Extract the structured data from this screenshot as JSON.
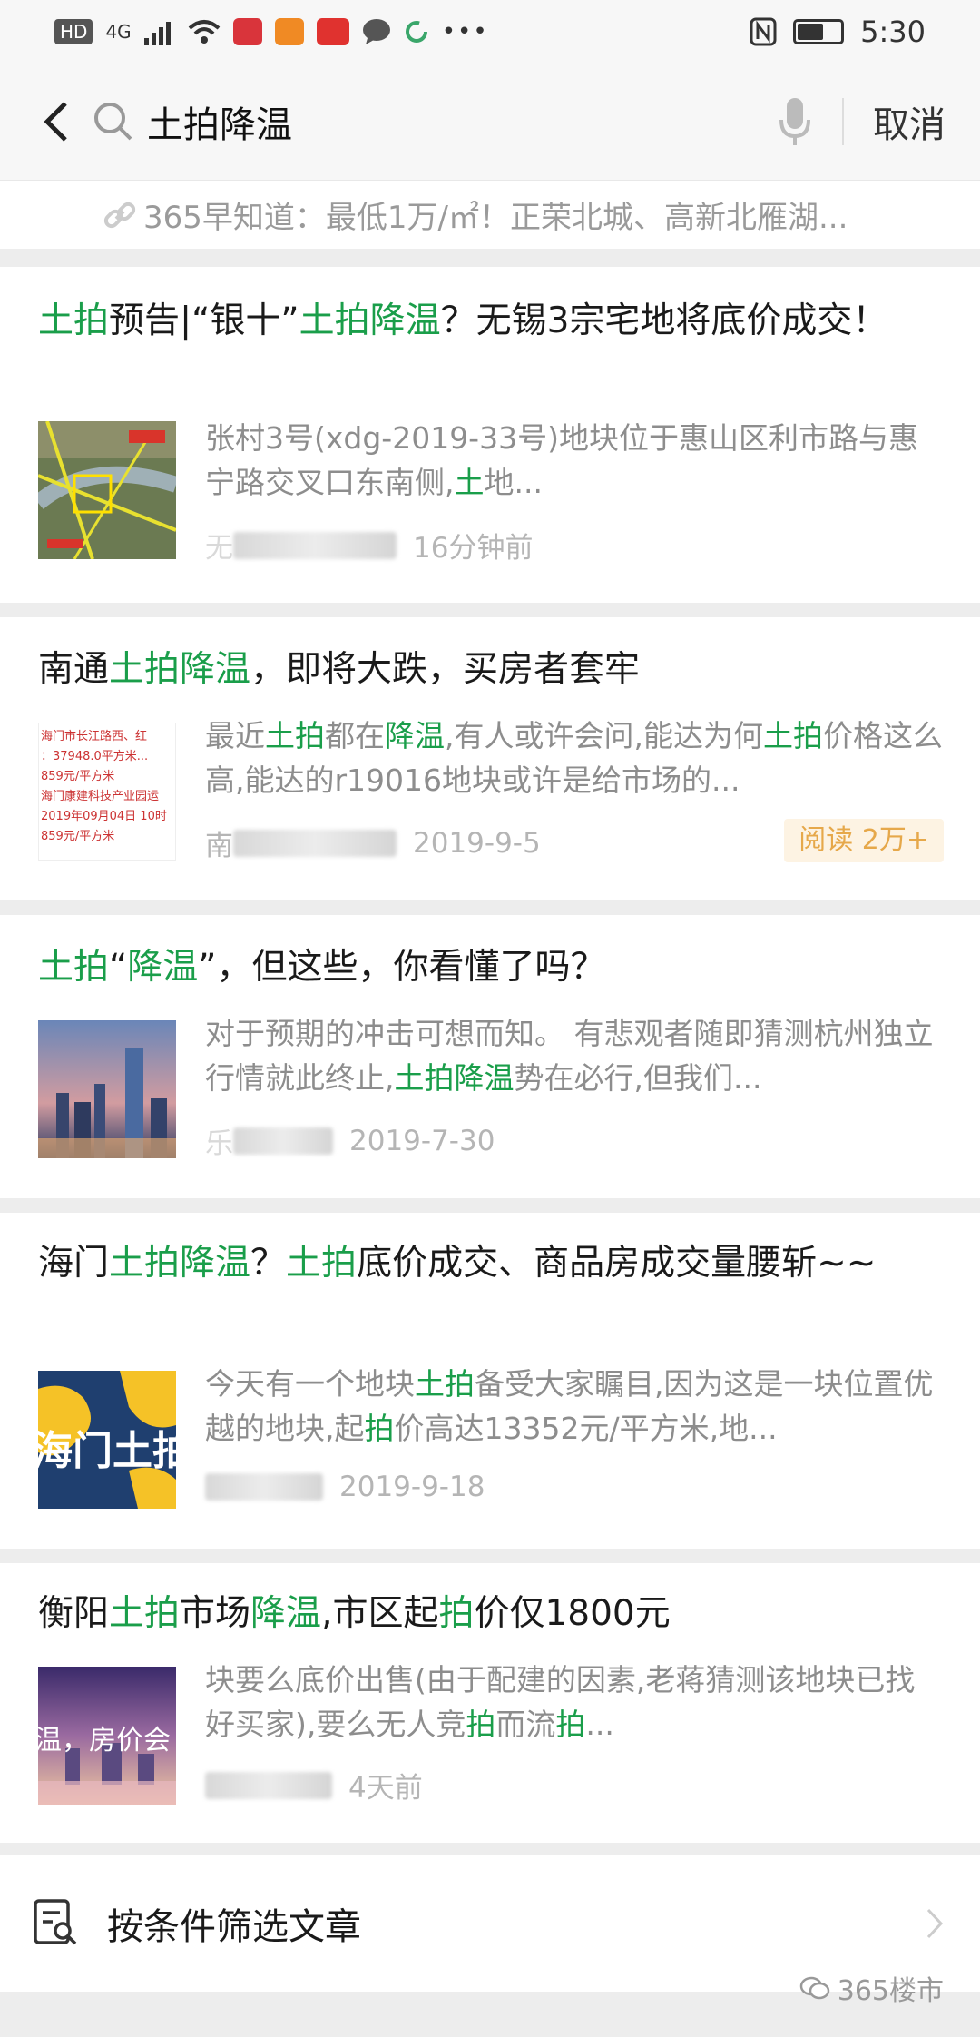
{
  "status": {
    "left_tags": [
      "HD",
      "4G"
    ],
    "time": "5:30",
    "battery_level": 0.6
  },
  "search": {
    "query": "土拍降温",
    "cancel_label": "取消"
  },
  "crumb": {
    "text": "365早知道：最低1万/㎡！正荣北城、高新北雁湖..."
  },
  "articles": [
    {
      "title_parts": [
        [
          "土拍",
          "hl"
        ],
        [
          "预告|“银十”",
          ""
        ],
        [
          "土拍降温",
          "hl"
        ],
        [
          "？无锡3宗宅地将底价成交！",
          ""
        ]
      ],
      "snippet_parts": [
        [
          "张村3号(xdg-2019-33号)地块位于惠山区利市路与惠宁路交叉口东南侧,",
          ""
        ],
        [
          "土",
          "hl"
        ],
        [
          "地...",
          ""
        ]
      ],
      "source": "无",
      "time": "16分钟前",
      "reads": ""
    },
    {
      "title_parts": [
        [
          "南通",
          ""
        ],
        [
          "土拍降温",
          "hl"
        ],
        [
          "，即将大跌，买房者套牢",
          ""
        ]
      ],
      "snippet_parts": [
        [
          "最近",
          ""
        ],
        [
          "土拍",
          "hl"
        ],
        [
          "都在",
          ""
        ],
        [
          "降温",
          "hl"
        ],
        [
          ",有人或许会问,能达为何",
          ""
        ],
        [
          "土拍",
          "hl"
        ],
        [
          "价格这么高,能达的r19016地块或许是给市场的...",
          ""
        ]
      ],
      "source": "南",
      "time": "2019-9-5",
      "reads": "阅读 2万+"
    },
    {
      "title_parts": [
        [
          "土拍",
          "hl"
        ],
        [
          "“",
          ""
        ],
        [
          "降温",
          "hl"
        ],
        [
          "”，但这些，你看懂了吗？",
          ""
        ]
      ],
      "snippet_parts": [
        [
          "对于预期的冲击可想而知。 有悲观者随即猜测杭州独立行情就此终止,",
          ""
        ],
        [
          "土拍降温",
          "hl"
        ],
        [
          "势在必行,但我们...",
          ""
        ]
      ],
      "source": "乐",
      "time": "2019-7-30",
      "reads": ""
    },
    {
      "title_parts": [
        [
          "海门",
          ""
        ],
        [
          "土拍降温",
          "hl"
        ],
        [
          "？",
          ""
        ],
        [
          "土拍",
          "hl"
        ],
        [
          "底价成交、商品房成交量腰斩~~",
          ""
        ]
      ],
      "snippet_parts": [
        [
          "今天有一个地块",
          ""
        ],
        [
          "土拍",
          "hl"
        ],
        [
          "备受大家瞩目,因为这是一块位置优越的地块,起",
          ""
        ],
        [
          "拍",
          "hl"
        ],
        [
          "价高达13352元/平方米,地...",
          ""
        ]
      ],
      "source": "",
      "time": "2019-9-18",
      "reads": ""
    },
    {
      "title_parts": [
        [
          "衡阳",
          ""
        ],
        [
          "土拍",
          "hl"
        ],
        [
          "市场",
          ""
        ],
        [
          "降温",
          "hl"
        ],
        [
          ",市区起",
          ""
        ],
        [
          "拍",
          "hl"
        ],
        [
          "价仅1800元",
          ""
        ]
      ],
      "snippet_parts": [
        [
          "块要么底价出售(由于配建的因素,老蒋猜测该地块已找好买家),要么无人竞",
          ""
        ],
        [
          "拍",
          "hl"
        ],
        [
          "而流",
          ""
        ],
        [
          "拍",
          "hl"
        ],
        [
          "...",
          ""
        ]
      ],
      "source": "",
      "time": "4天前",
      "reads": ""
    }
  ],
  "thumb_text": {
    "nantong": [
      "海门市长江路西、红",
      "：37948.0平方米...",
      "859元/平方米",
      "海门康建科技产业园运",
      "2019年09月04日 10时",
      "859元/平方米"
    ],
    "haimen": "海门土拍",
    "hengyang": "温，房价会"
  },
  "filter": {
    "label": "按条件筛选文章"
  },
  "watermark": "365楼市",
  "colors": {
    "highlight": "#1a9e4a",
    "reads_bg": "#fdf3e3",
    "reads_text": "#e6a84a"
  }
}
